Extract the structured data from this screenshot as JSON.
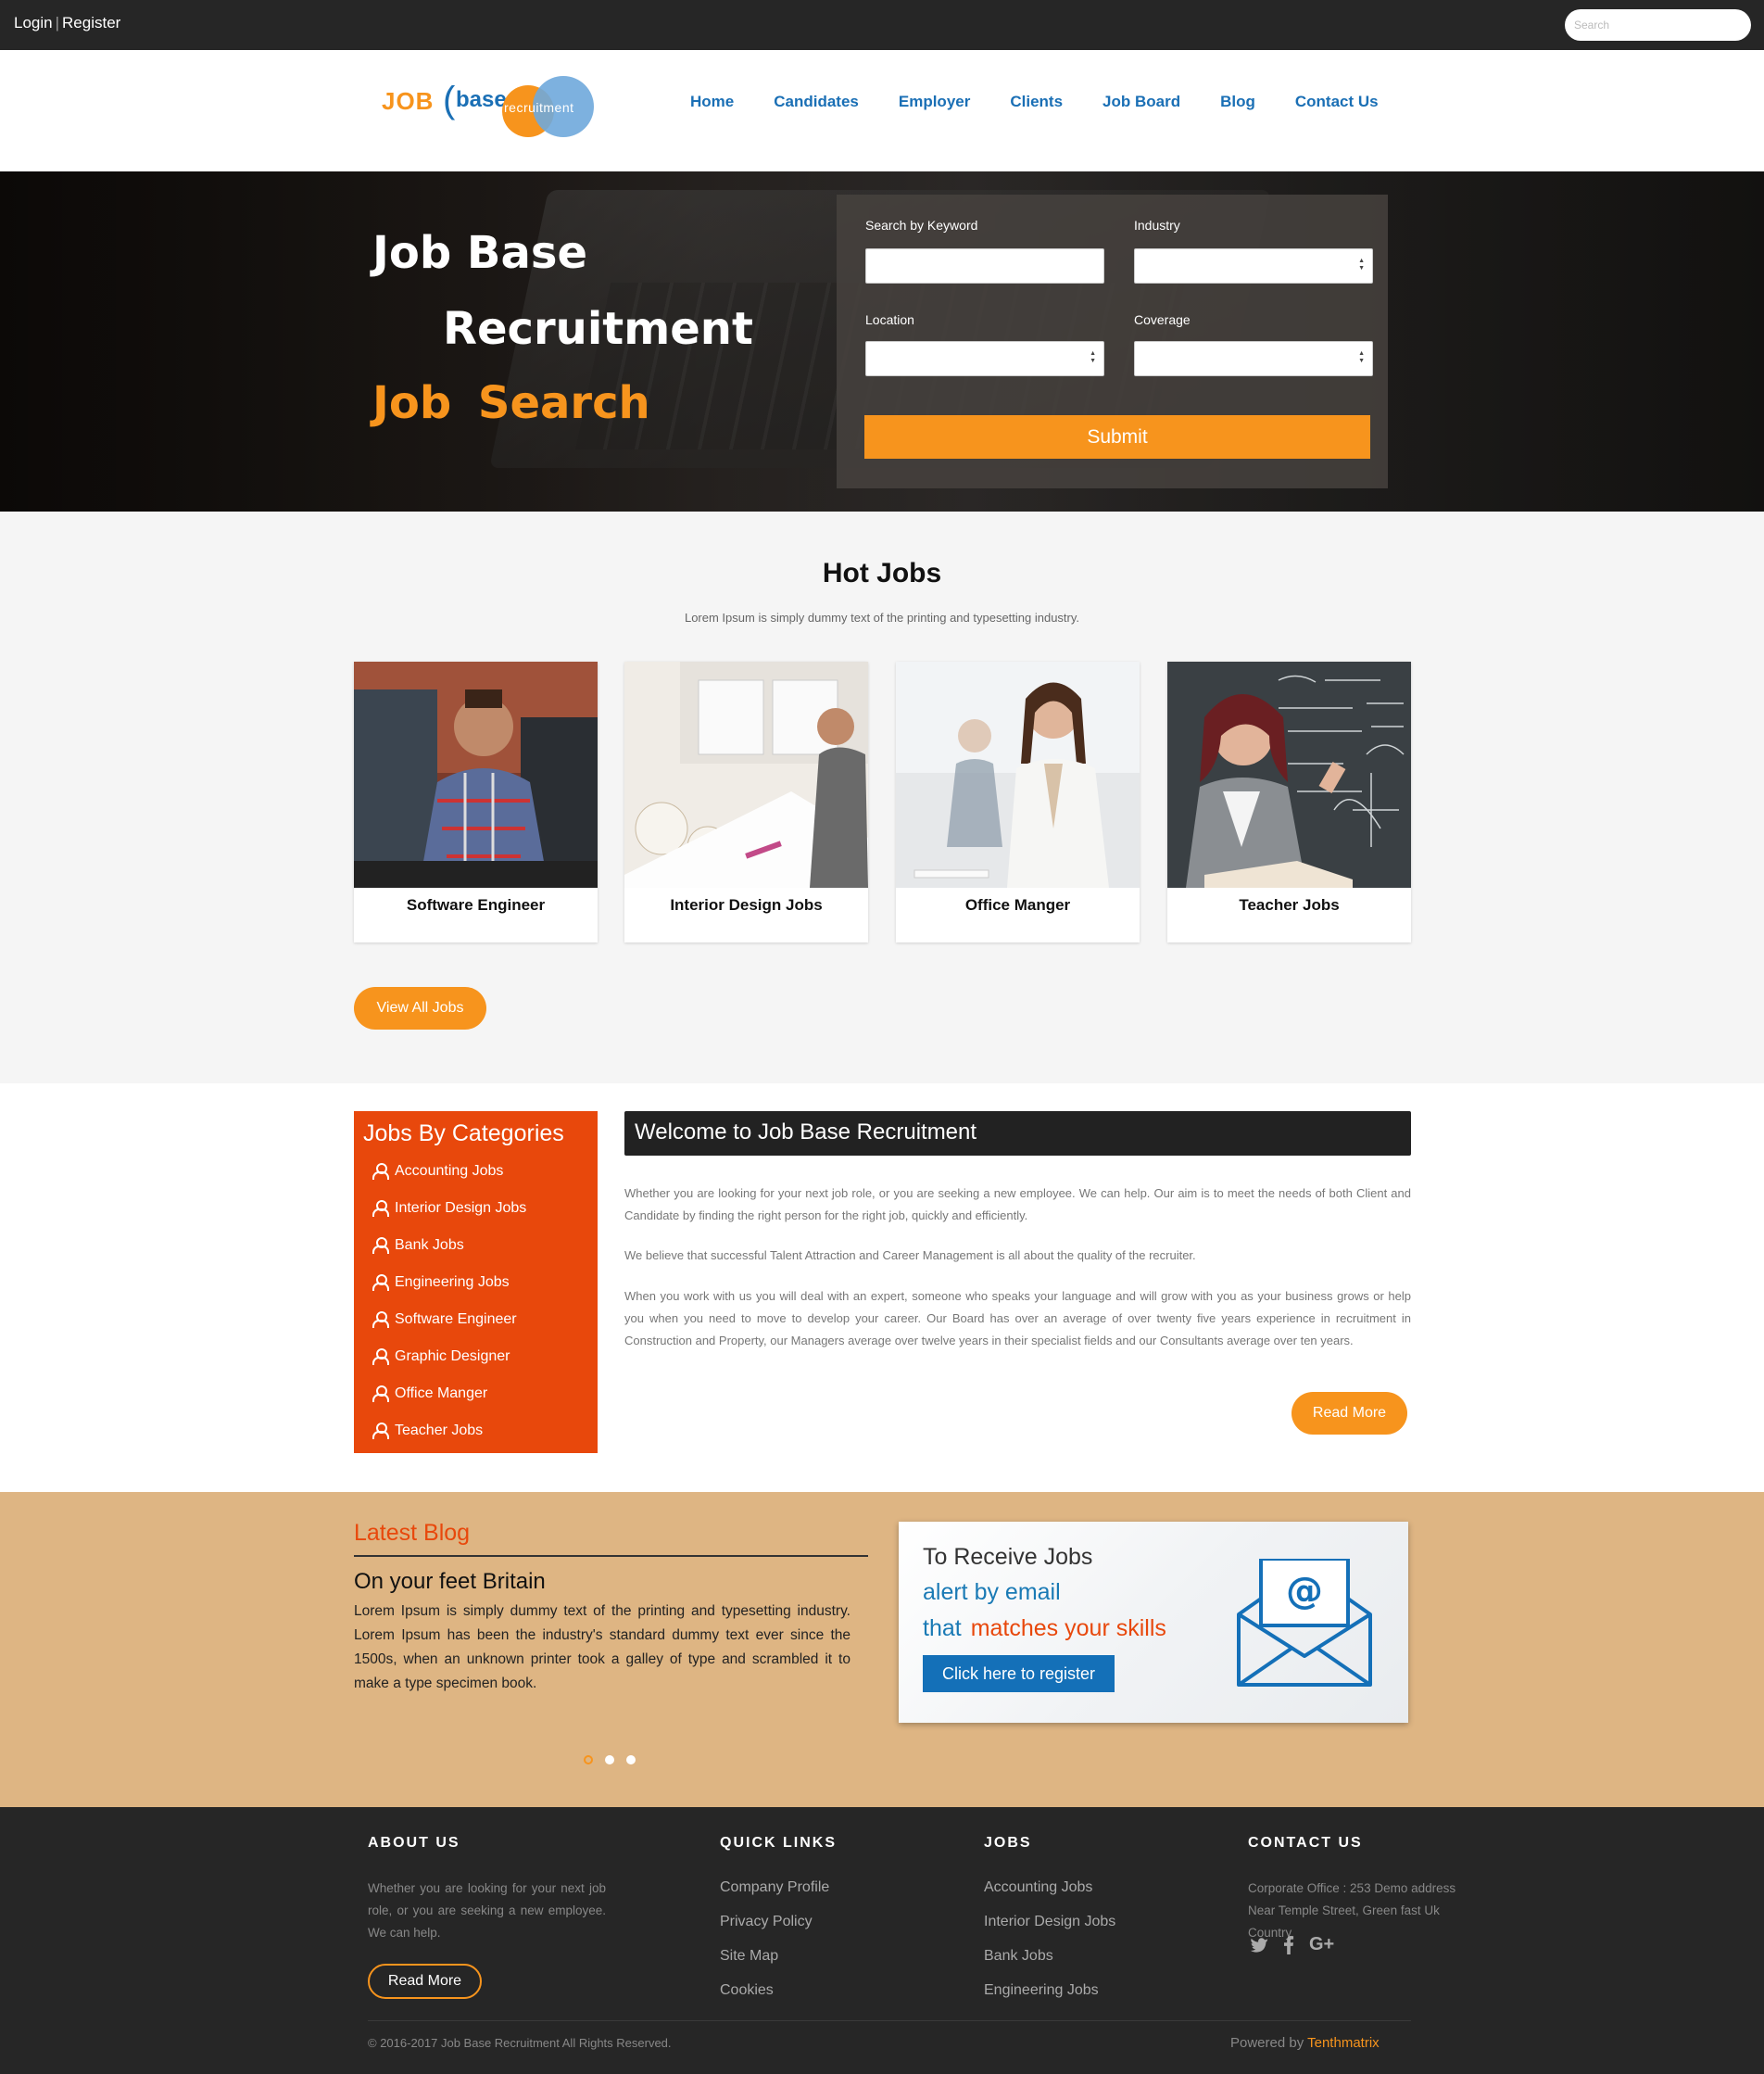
{
  "topbar": {
    "login": "Login",
    "separator": "|",
    "register": "Register",
    "search_placeholder": "Search"
  },
  "logo": {
    "job": "JOB",
    "paren": "(",
    "base": "base",
    "recruitment": "recruitment"
  },
  "nav": [
    "Home",
    "Candidates",
    "Employer",
    "Clients",
    "Job Board",
    "Blog",
    "Contact Us"
  ],
  "hero": {
    "line1": "Job Base",
    "line2": "Recruitment",
    "line3": "Job Search",
    "form": {
      "keyword_label": "Search by Keyword",
      "industry_label": "Industry",
      "location_label": "Location",
      "coverage_label": "Coverage",
      "submit": "Submit"
    }
  },
  "hot_jobs": {
    "title": "Hot Jobs",
    "subtitle": "Lorem Ipsum is simply dummy text of the printing and typesetting industry.",
    "cards": [
      {
        "caption": "Software Engineer"
      },
      {
        "caption": "Interior Design Jobs"
      },
      {
        "caption": "Office Manger"
      },
      {
        "caption": "Teacher Jobs"
      }
    ],
    "view_all": "View All Jobs"
  },
  "categories": {
    "title": "Jobs By Categories",
    "items": [
      "Accounting Jobs",
      "Interior Design Jobs",
      "Bank Jobs",
      "Engineering Jobs",
      "Software Engineer",
      "Graphic Designer",
      "Office Manger",
      "Teacher Jobs"
    ]
  },
  "welcome": {
    "title": "Welcome to Job Base Recruitment",
    "p1": "Whether you are looking for your next job role, or you are seeking a new employee. We can help. Our aim is to meet the needs of both Client and Candidate by finding the right person for the right job, quickly and efficiently.",
    "p2": "We believe that successful Talent Attraction and Career Management is all about the quality of the recruiter.",
    "p3": "When you work with us you will deal with an expert, someone who speaks your language and will grow with you as your business grows or help you when you need to move to develop your career. Our Board has over an average of over twenty five years experience in recruitment in Construction and Property, our Managers average over twelve years in their specialist fields and our Consultants average over ten years.",
    "read_more": "Read More"
  },
  "blog": {
    "title": "Latest Blog",
    "post_title": "On your feet Britain",
    "post_body": "Lorem Ipsum is simply dummy text of the printing and typesetting industry. Lorem Ipsum has been the industry's standard dummy text ever since the 1500s, when an unknown printer took a galley of type and scrambled it to make a type specimen book."
  },
  "promo": {
    "line1": "To Receive Jobs",
    "line2": "alert by email",
    "line3a": "that",
    "line3b": "matches your skills",
    "button": "Click here to register"
  },
  "footer": {
    "about_title": "ABOUT US",
    "about_text": "Whether you are looking for your next job role, or you are seeking a new employee. We can help.",
    "about_button": "Read More",
    "quick_title": "QUICK LINKS",
    "quick_links": [
      "Company Profile",
      "Privacy Policy",
      "Site Map",
      "Cookies"
    ],
    "jobs_title": "JOBS",
    "jobs_links": [
      "Accounting Jobs",
      "Interior Design Jobs",
      "Bank Jobs",
      "Engineering Jobs"
    ],
    "contact_title": "CONTACT US",
    "contact_text": "Corporate Office : 253 Demo address Near Temple Street, Green fast Uk Country",
    "social": [
      "twitter-icon",
      "facebook-icon",
      "google-plus-icon"
    ],
    "copyright": "© 2016-2017 Job Base Recruitment All Rights Reserved.",
    "powered_prefix": "Powered by",
    "powered_brand": "Tenthmatrix"
  },
  "colors": {
    "accent_orange": "#f7941d",
    "category_red": "#e8480c",
    "brand_blue": "#1a6fb5",
    "band_tan": "#deb583",
    "dark": "#262626"
  }
}
